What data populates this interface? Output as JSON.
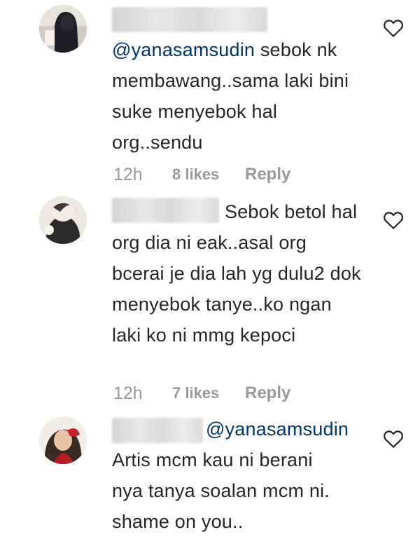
{
  "colors": {
    "text": "#262626",
    "mention": "#003569",
    "meta": "#999999",
    "background": "#ffffff"
  },
  "comments": [
    {
      "mention": "@yanasamsudin",
      "text": " sebok nk membawang..sama laki bini suke menyebok hal org..sendu",
      "time": "12h",
      "likes": "8 likes",
      "reply": "Reply",
      "like_icon": "heart-outline-icon"
    },
    {
      "mention": "",
      "text": "Sebok betol hal org dia ni eak..asal org bcerai je dia lah yg dulu2 dok menyebok tanye..ko ngan laki ko ni mmg kepoci",
      "time": "12h",
      "likes": "7 likes",
      "reply": "Reply",
      "like_icon": "heart-outline-icon"
    },
    {
      "mention": "@yanasamsudin",
      "text": "Artis mcm kau ni berani nya tanya soalan mcm ni. shame on you..",
      "time": "",
      "likes": "",
      "reply": "",
      "like_icon": "heart-outline-icon"
    }
  ]
}
